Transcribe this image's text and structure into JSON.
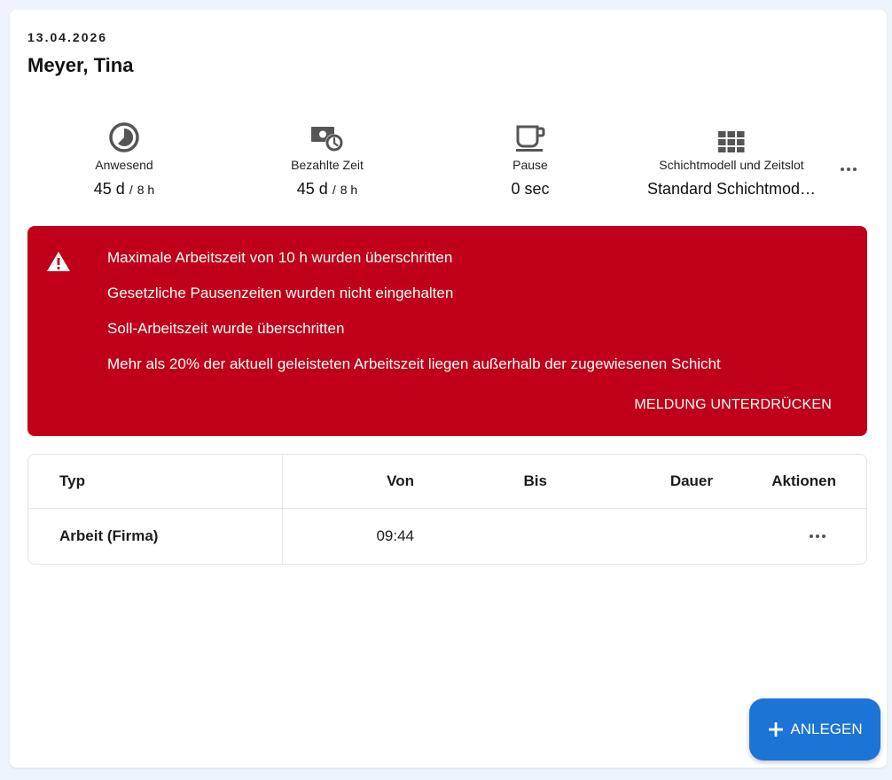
{
  "header": {
    "date": "13.04.2026",
    "name": "Meyer, Tina"
  },
  "stats": {
    "present": {
      "icon": "pie-clock-icon",
      "label": "Anwesend",
      "value": "45 d",
      "sep": "/",
      "sub": "8 h"
    },
    "paid": {
      "icon": "money-clock-icon",
      "label": "Bezahlte Zeit",
      "value": "45 d",
      "sep": "/",
      "sub": "8 h"
    },
    "pause": {
      "icon": "coffee-cup-icon",
      "label": "Pause",
      "value": "0 sec"
    },
    "shift": {
      "icon": "grid-icon",
      "label": "Schichtmodell und Zeitslot",
      "value": "Standard Schichtmod…"
    },
    "more_icon": "more-horizontal-icon"
  },
  "alert": {
    "color": "#c0001a",
    "icon": "warning-triangle-icon",
    "messages": [
      "Maximale Arbeitszeit von 10 h wurden überschritten",
      "Gesetzliche Pausenzeiten wurden nicht eingehalten",
      "Soll-Arbeitszeit wurde überschritten",
      "Mehr als 20% der aktuell geleisteten Arbeitszeit liegen außerhalb der zugewiesenen Schicht"
    ],
    "action": "MELDUNG UNTERDRÜCKEN"
  },
  "table": {
    "columns": {
      "typ": "Typ",
      "von": "Von",
      "bis": "Bis",
      "dauer": "Dauer",
      "aktionen": "Aktionen"
    },
    "rows": [
      {
        "typ": "Arbeit (Firma)",
        "von": "09:44",
        "bis": "",
        "dauer": ""
      }
    ]
  },
  "fab": {
    "icon": "plus-icon",
    "label": "ANLEGEN",
    "color": "#1b74d6"
  }
}
